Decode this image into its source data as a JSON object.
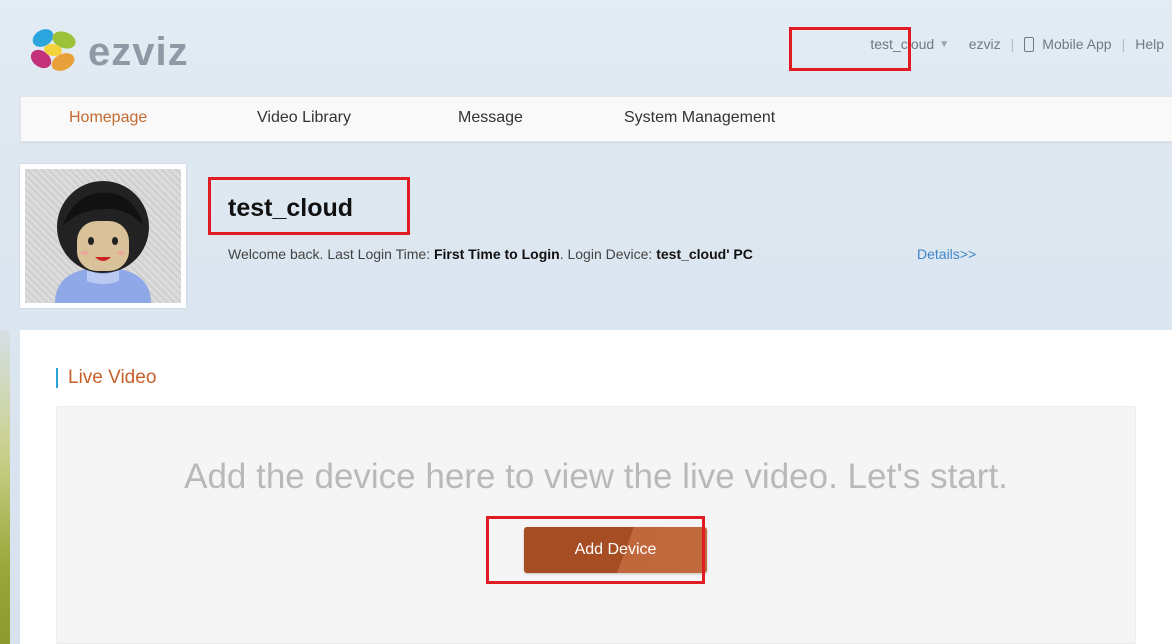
{
  "brand": {
    "logo_text": "ezviz"
  },
  "header": {
    "account": "test_cloud",
    "user_link": "ezviz",
    "mobile_app": "Mobile App",
    "help": "Help"
  },
  "nav": {
    "items": [
      {
        "label": "Homepage",
        "active": true
      },
      {
        "label": "Video Library",
        "active": false
      },
      {
        "label": "Message",
        "active": false
      },
      {
        "label": "System Management",
        "active": false
      }
    ]
  },
  "profile": {
    "username": "test_cloud",
    "welcome_prefix": "Welcome back. Last Login Time: ",
    "last_login": "First Time to Login",
    "device_prefix": ". Login Device: ",
    "device": "test_cloud' PC",
    "details_link": "Details>>"
  },
  "live_video": {
    "section_title": "Live Video",
    "empty_message": "Add the device here to view the live video. Let's start.",
    "add_button": "Add Device"
  },
  "colors": {
    "accent_orange": "#c46a30",
    "button_brown": "#a64d24",
    "link_blue": "#3f86c6",
    "highlight_red": "#e11b24",
    "section_bar_blue": "#27a5d8"
  }
}
